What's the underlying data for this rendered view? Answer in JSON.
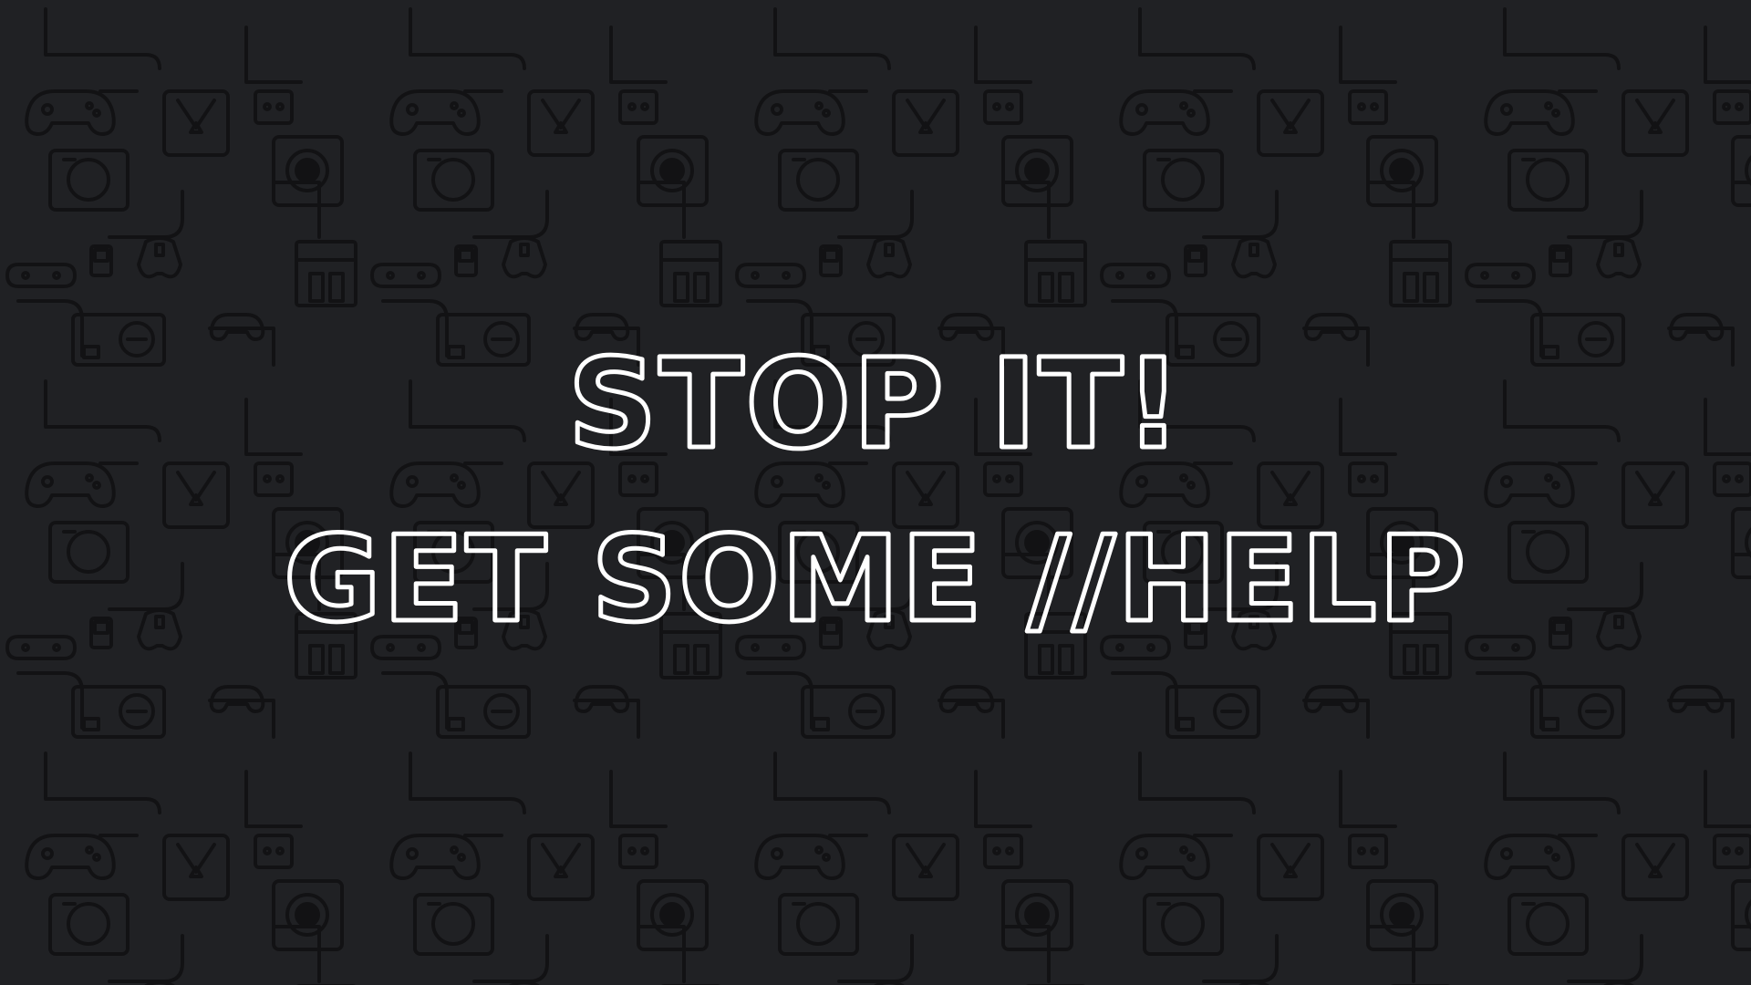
{
  "background": {
    "color": "#202124",
    "pattern_color": "#121214",
    "pattern_icons": [
      "gamepad-icon",
      "game-console-icon",
      "discord-icon",
      "handheld-console-icon",
      "cable-line"
    ]
  },
  "headline": {
    "line1": "STOP IT!",
    "line2": "GET SOME //HELP",
    "outline_color": "#ffffff"
  }
}
